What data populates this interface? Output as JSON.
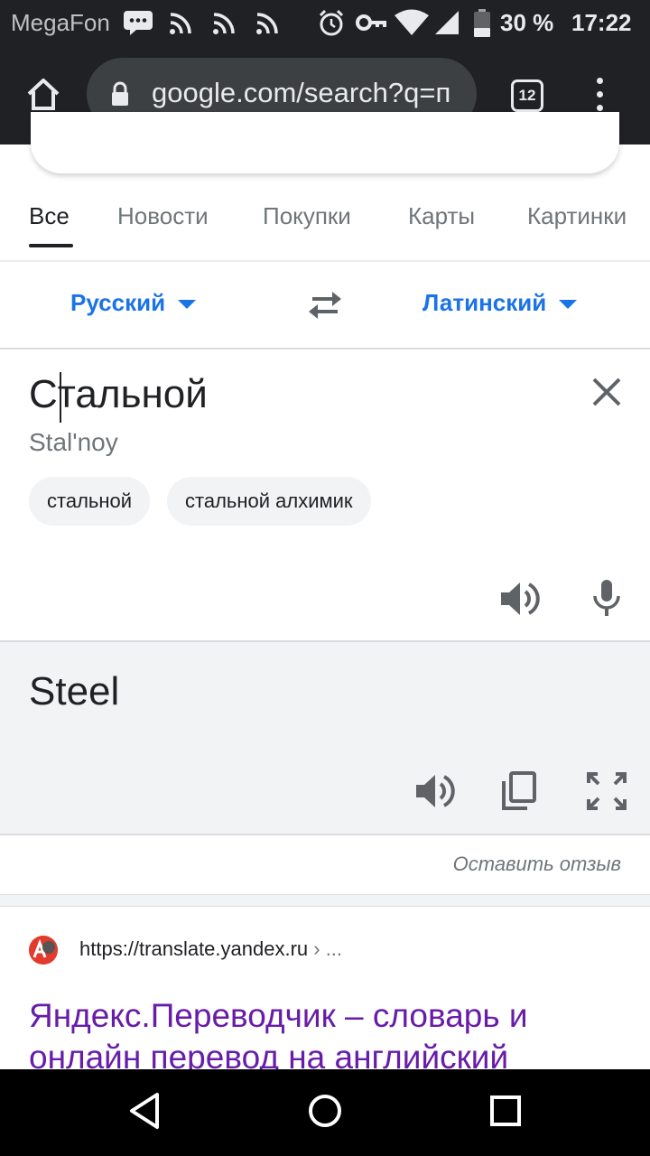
{
  "status_bar": {
    "carrier": "MegaFon",
    "battery_percent": "30 %",
    "time": "17:22",
    "icons": [
      "message-icon",
      "cast-icon",
      "cast-icon",
      "cast-icon",
      "alarm-icon",
      "key-icon",
      "wifi-icon",
      "signal-icon",
      "battery-icon"
    ]
  },
  "browser": {
    "url": "google.com/search?q=п",
    "tab_count": "12",
    "icons": [
      "home-icon",
      "lock-icon",
      "tabs-icon",
      "menu-icon"
    ]
  },
  "search_tabs": [
    {
      "label": "Все",
      "active": true
    },
    {
      "label": "Новости",
      "active": false
    },
    {
      "label": "Покупки",
      "active": false
    },
    {
      "label": "Карты",
      "active": false
    },
    {
      "label": "Картинки",
      "active": false
    }
  ],
  "translator": {
    "source_language": "Русский",
    "target_language": "Латинский",
    "source_text": "Стальной",
    "transliteration": "Stal'noy",
    "suggestions": [
      "стальной",
      "стальной алхимик"
    ],
    "result_text": "Steel",
    "feedback_label": "Оставить отзыв"
  },
  "search_result": {
    "url": "https://translate.yandex.ru",
    "url_suffix": " › ...",
    "title": "Яндекс.Переводчик – словарь и онлайн перевод на английский"
  },
  "colors": {
    "accent": "#1a73e8",
    "visited_link": "#681da8",
    "panel_bg": "#f1f3f4",
    "toolbar_bg": "#202124"
  }
}
